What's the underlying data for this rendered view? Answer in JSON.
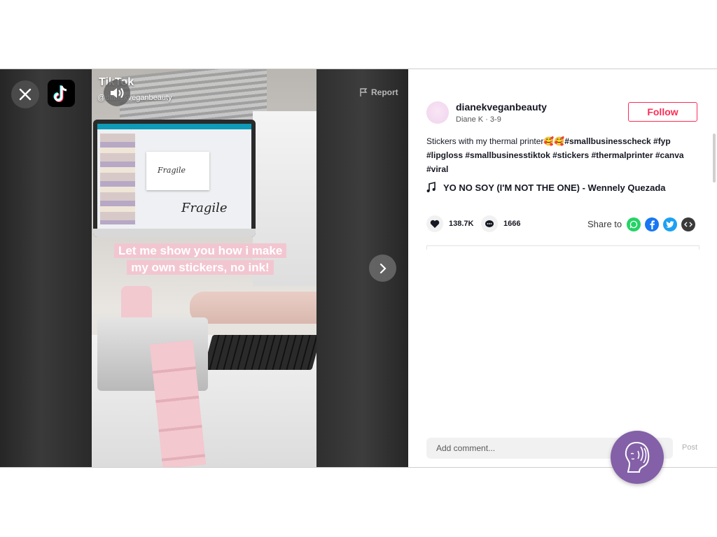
{
  "video": {
    "caption": "Let me show you how i make my own stickers, no ink!",
    "watermark_logo": "TikTok",
    "watermark_user": "@dianekveganbeauty",
    "report_label": "Report",
    "screen_text_small": "Fragile",
    "screen_text_big": "Fragile"
  },
  "post": {
    "username": "dianekveganbeauty",
    "display_name": "Diane K",
    "date": "3-9",
    "follow_label": "Follow",
    "description_text": "Stickers with my thermal printer🥰🥰",
    "hashtags": [
      "#smallbusinesscheck",
      "#fyp",
      "#lipgloss",
      "#smallbusinesstiktok",
      "#stickers",
      "#thermalprinter",
      "#canva",
      "#viral"
    ],
    "music": "YO NO SOY (I'M NOT THE ONE) - Wennely Quezada",
    "likes": "138.7K",
    "comments": "1666",
    "share_label": "Share to",
    "share_targets": [
      "whatsapp-icon",
      "facebook-icon",
      "twitter-icon",
      "embed-icon"
    ]
  },
  "comment_box": {
    "placeholder": "Add comment...",
    "post_label": "Post"
  },
  "colors": {
    "accent": "#fe2c55",
    "whatsapp": "#25d366",
    "facebook": "#1877f2",
    "twitter": "#1da1f2",
    "embed": "#3a3a3a",
    "badge": "#8460a8"
  }
}
